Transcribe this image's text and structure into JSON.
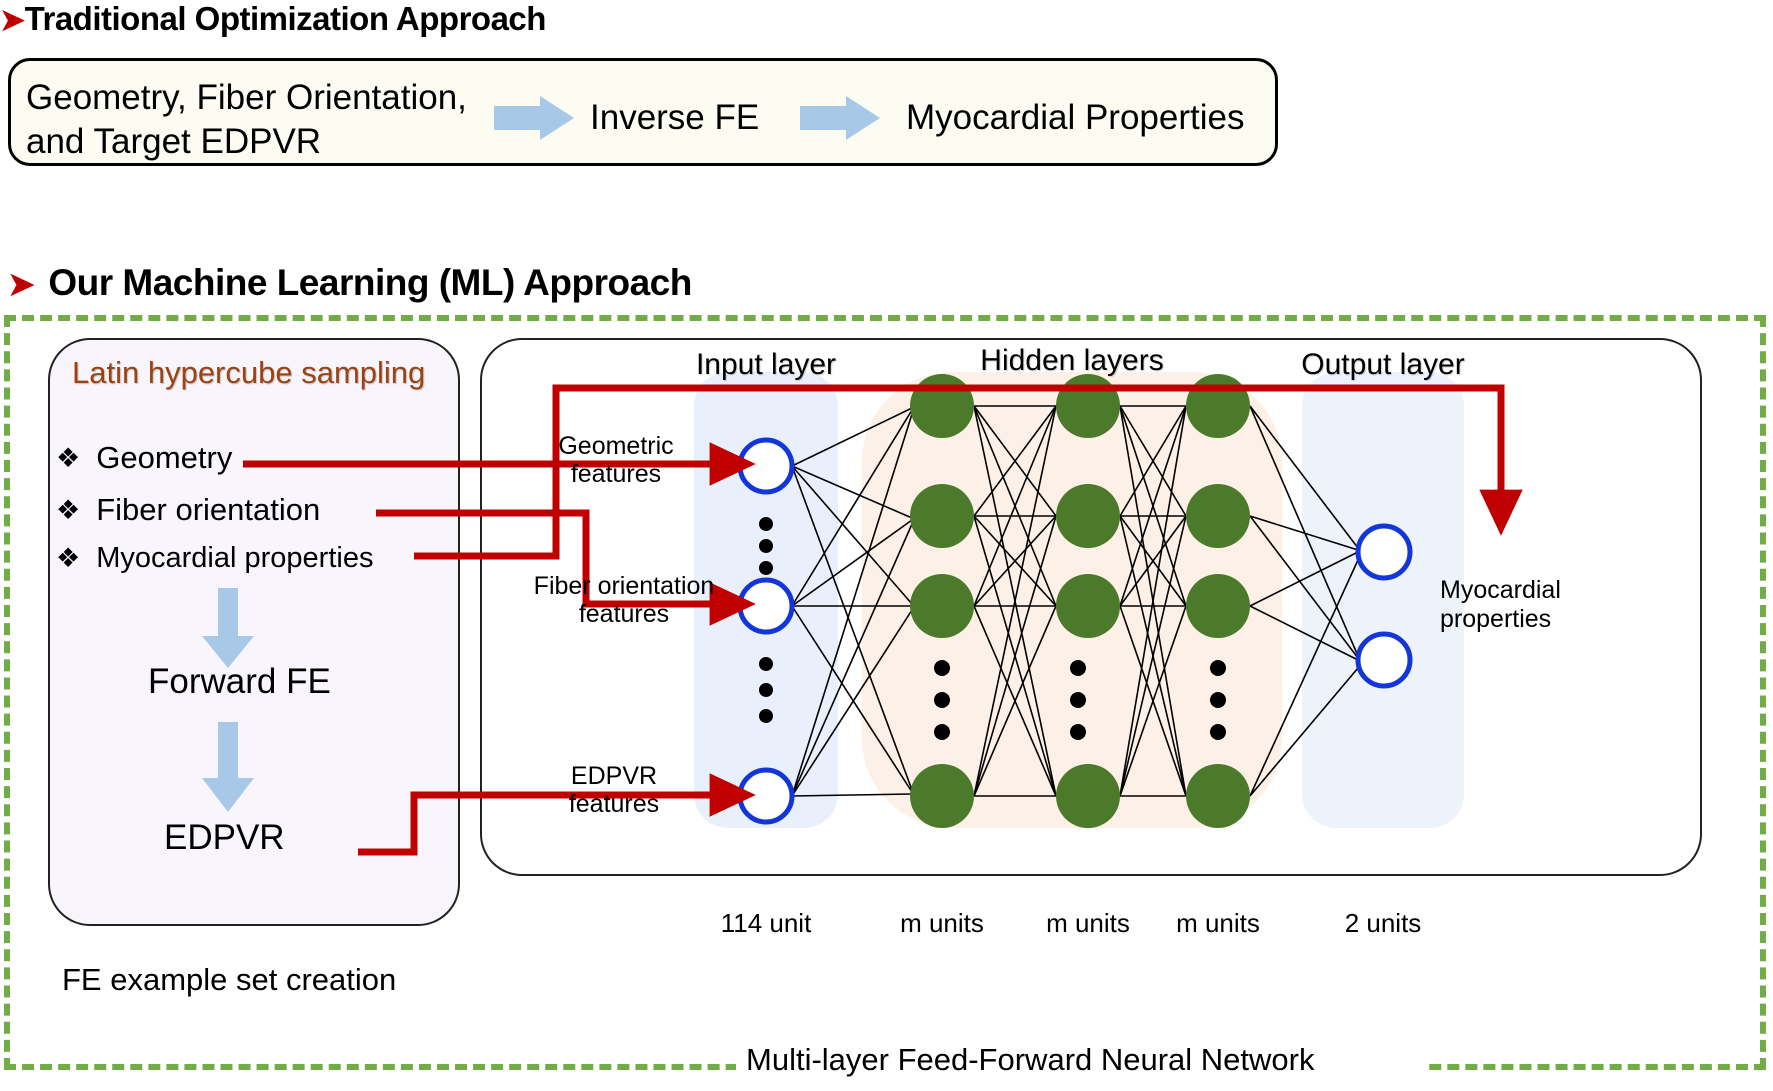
{
  "sections": {
    "traditional": {
      "bullet_glyph": "➤",
      "heading": "Traditional Optimization Approach",
      "box": {
        "input_line1": "Geometry, Fiber Orientation,",
        "input_line2": "and Target EDPVR",
        "step": "Inverse FE",
        "output": "Myocardial Properties",
        "arrow1_name": "right-arrow-icon",
        "arrow2_name": "right-arrow-icon"
      }
    },
    "ml": {
      "bullet_glyph": "➤",
      "heading": "Our Machine Learning (ML) Approach",
      "left_panel": {
        "title": "Latin hypercube sampling",
        "bullet_glyph": "❖",
        "bullets": [
          "Geometry",
          "Fiber orientation",
          "Myocardial properties"
        ],
        "step1": "Forward FE",
        "step2": "EDPVR",
        "caption": "FE example set creation"
      },
      "network": {
        "layer_titles": {
          "input": "Input layer",
          "hidden": "Hidden layers",
          "output": "Output layer"
        },
        "unit_labels": {
          "input": "114 unit",
          "hidden": [
            "m units",
            "m units",
            "m units"
          ],
          "output": "2 units"
        },
        "feature_labels": [
          {
            "line1": "Geometric",
            "line2": "features"
          },
          {
            "line1": "Fiber orientation",
            "line2": "features"
          },
          {
            "line1": "EDPVR",
            "line2": "features"
          }
        ],
        "output_label": {
          "line1": "Myocardial",
          "line2": "properties"
        },
        "caption": "Multi-layer Feed-Forward Neural Network"
      }
    }
  },
  "colors": {
    "red_accent": "#c00000",
    "green_dash": "#70ad47",
    "blue_arrow": "#a8c8e8",
    "node_green": "#4a7a2a",
    "node_outline_blue": "#1336d8",
    "brown_title": "#9c4312",
    "input_band": "#eaf0fb",
    "hidden_band": "#fdf0e6",
    "output_band": "#eef2fb",
    "trad_box_bg": "#fdfcf3",
    "left_panel_bg": "#f8f5fd"
  }
}
